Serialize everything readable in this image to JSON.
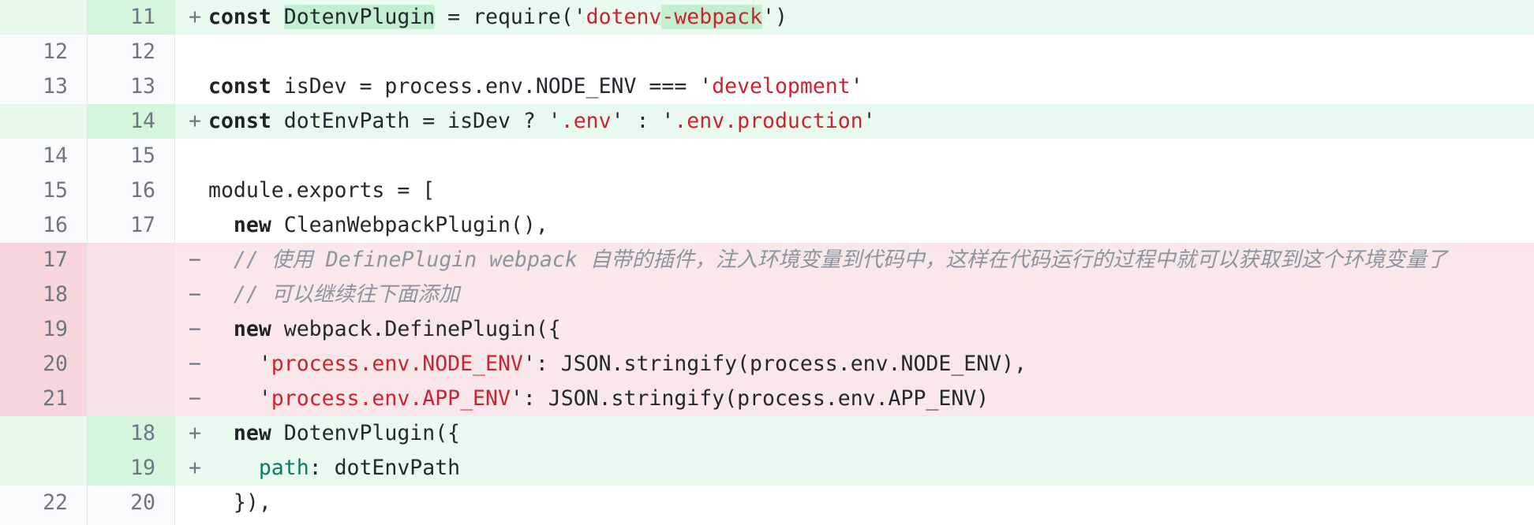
{
  "lines": [
    {
      "type": "add",
      "old": "",
      "new": "11",
      "marker": "+",
      "parts": [
        {
          "k": "kw",
          "t": "const"
        },
        {
          "k": "",
          "t": " "
        },
        {
          "k": "hl",
          "t": "DotenvPlugin"
        },
        {
          "k": "",
          "t": " = require('"
        },
        {
          "k": "str",
          "t": "dotenv"
        },
        {
          "k": "str hl",
          "t": "-webpack"
        },
        {
          "k": "",
          "t": "')"
        }
      ]
    },
    {
      "type": "ctx",
      "old": "12",
      "new": "12",
      "marker": "",
      "parts": []
    },
    {
      "type": "ctx",
      "old": "13",
      "new": "13",
      "marker": "",
      "parts": [
        {
          "k": "kw",
          "t": "const"
        },
        {
          "k": "",
          "t": " isDev = process.env.NODE_ENV === '"
        },
        {
          "k": "str",
          "t": "development"
        },
        {
          "k": "",
          "t": "'"
        }
      ]
    },
    {
      "type": "add",
      "old": "",
      "new": "14",
      "marker": "+",
      "parts": [
        {
          "k": "kw",
          "t": "const"
        },
        {
          "k": "",
          "t": " dotEnvPath = isDev ? '"
        },
        {
          "k": "str",
          "t": ".env"
        },
        {
          "k": "",
          "t": "' : '"
        },
        {
          "k": "str",
          "t": ".env.production"
        },
        {
          "k": "",
          "t": "'"
        }
      ]
    },
    {
      "type": "ctx",
      "old": "14",
      "new": "15",
      "marker": "",
      "parts": []
    },
    {
      "type": "ctx",
      "old": "15",
      "new": "16",
      "marker": "",
      "parts": [
        {
          "k": "",
          "t": "module.exports = ["
        }
      ]
    },
    {
      "type": "ctx",
      "old": "16",
      "new": "17",
      "marker": "",
      "parts": [
        {
          "k": "",
          "t": "  "
        },
        {
          "k": "kw",
          "t": "new"
        },
        {
          "k": "",
          "t": " CleanWebpackPlugin(),"
        }
      ]
    },
    {
      "type": "del",
      "old": "17",
      "new": "",
      "marker": "−",
      "parts": [
        {
          "k": "",
          "t": "  "
        },
        {
          "k": "cmt",
          "t": "// 使用 DefinePlugin webpack 自带的插件，注入环境变量到代码中，这样在代码运行的过程中就可以获取到这个环境变量了"
        }
      ]
    },
    {
      "type": "del",
      "old": "18",
      "new": "",
      "marker": "−",
      "parts": [
        {
          "k": "",
          "t": "  "
        },
        {
          "k": "cmt",
          "t": "// 可以继续往下面添加"
        }
      ]
    },
    {
      "type": "del",
      "old": "19",
      "new": "",
      "marker": "−",
      "parts": [
        {
          "k": "",
          "t": "  "
        },
        {
          "k": "kw",
          "t": "new"
        },
        {
          "k": "",
          "t": " webpack.DefinePlugin({"
        }
      ]
    },
    {
      "type": "del",
      "old": "20",
      "new": "",
      "marker": "−",
      "parts": [
        {
          "k": "",
          "t": "    '"
        },
        {
          "k": "str",
          "t": "process.env.NODE_ENV"
        },
        {
          "k": "",
          "t": "': JSON.stringify(process.env.NODE_ENV),"
        }
      ]
    },
    {
      "type": "del",
      "old": "21",
      "new": "",
      "marker": "−",
      "parts": [
        {
          "k": "",
          "t": "    '"
        },
        {
          "k": "str",
          "t": "process.env.APP_ENV"
        },
        {
          "k": "",
          "t": "': JSON.stringify(process.env.APP_ENV)"
        }
      ]
    },
    {
      "type": "add",
      "old": "",
      "new": "18",
      "marker": "+",
      "parts": [
        {
          "k": "",
          "t": "  "
        },
        {
          "k": "kw",
          "t": "new"
        },
        {
          "k": "",
          "t": " DotenvPlugin({"
        }
      ]
    },
    {
      "type": "add",
      "old": "",
      "new": "19",
      "marker": "+",
      "parts": [
        {
          "k": "",
          "t": "    "
        },
        {
          "k": "prop",
          "t": "path"
        },
        {
          "k": "",
          "t": ": dotEnvPath"
        }
      ]
    },
    {
      "type": "ctx",
      "old": "22",
      "new": "20",
      "marker": "",
      "parts": [
        {
          "k": "",
          "t": "  }),"
        }
      ]
    }
  ]
}
